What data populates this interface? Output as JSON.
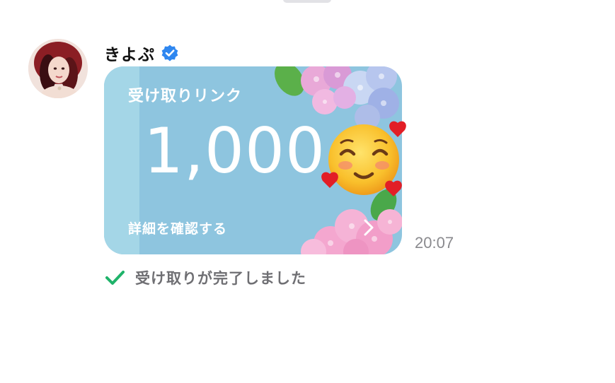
{
  "sender": {
    "name": "きよぷ",
    "verified_icon": "verified-badge-icon",
    "avatar": "user-avatar"
  },
  "gift_card": {
    "title": "受け取りリンク",
    "amount": "1,000",
    "detail_link": "詳細を確認する",
    "chevron_icon": "chevron-right-icon",
    "background_color": "#8ec5df"
  },
  "sticker": {
    "emoji": "smiling-face-with-hearts-icon"
  },
  "message": {
    "time": "20:07"
  },
  "status": {
    "icon": "check-icon",
    "text": "受け取りが完了しました",
    "icon_color": "#1fb36a"
  }
}
